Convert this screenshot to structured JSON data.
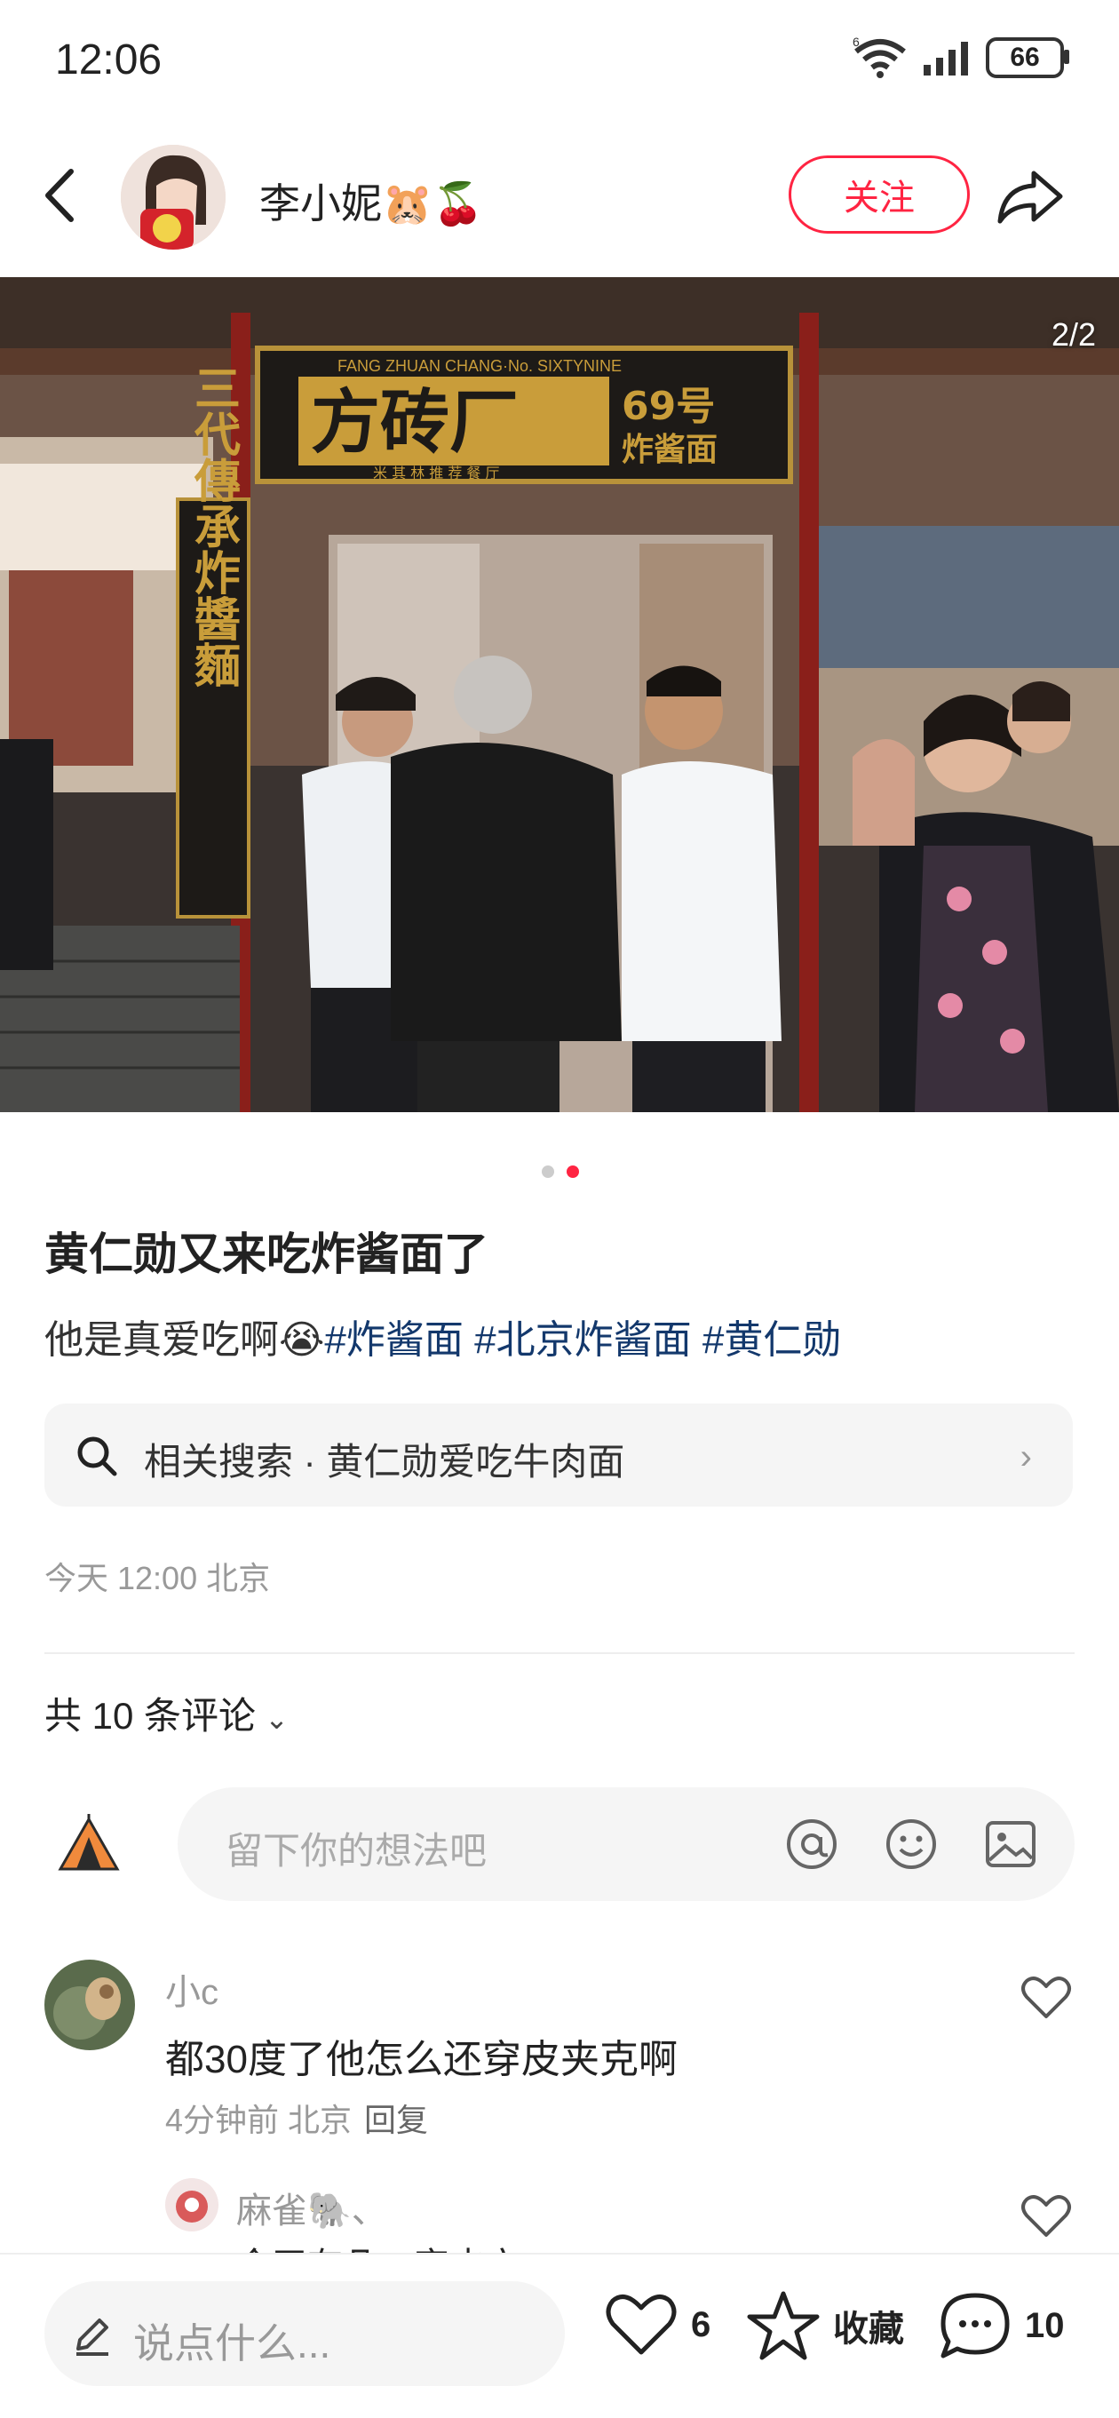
{
  "status_bar": {
    "time": "12:06",
    "network": "6",
    "battery": "66"
  },
  "header": {
    "username": "李小妮🐹🍒",
    "follow_label": "关注"
  },
  "photo": {
    "counter": "2/2",
    "sign_main": "方砖厂",
    "sign_sub_number": "69号",
    "sign_sub_text": "炸酱面",
    "sign_english": "FANG ZHUAN CHANG·No. SIXTYNINE",
    "sign_bottom": "米 其 林 推 荐 餐 厅",
    "pillar_text": "三代傳承炸醬麵"
  },
  "post": {
    "title": "黄仁勋又来吃炸酱面了",
    "desc_text": "他是真爱吃啊😭",
    "hashtags": [
      "#炸酱面",
      "#北京炸酱面",
      "#黄仁勋"
    ],
    "related_search": "相关搜索 · 黄仁勋爱吃牛肉面",
    "meta": "今天 12:00 北京"
  },
  "comments": {
    "count_label": "共 10 条评论",
    "input_placeholder": "留下你的想法吧",
    "items": [
      {
        "name": "小c",
        "text": "都30度了他怎么还穿皮夹克啊",
        "meta": "4分钟前 北京",
        "reply": "回复"
      },
      {
        "name": "麻雀🐘、",
        "text": "今天有几…穿皮衣"
      }
    ]
  },
  "bottom_bar": {
    "say_placeholder": "说点什么...",
    "likes": "6",
    "collect_label": "收藏",
    "comments": "10"
  },
  "colors": {
    "accent": "#ff2442",
    "hashtag": "#13386c"
  }
}
